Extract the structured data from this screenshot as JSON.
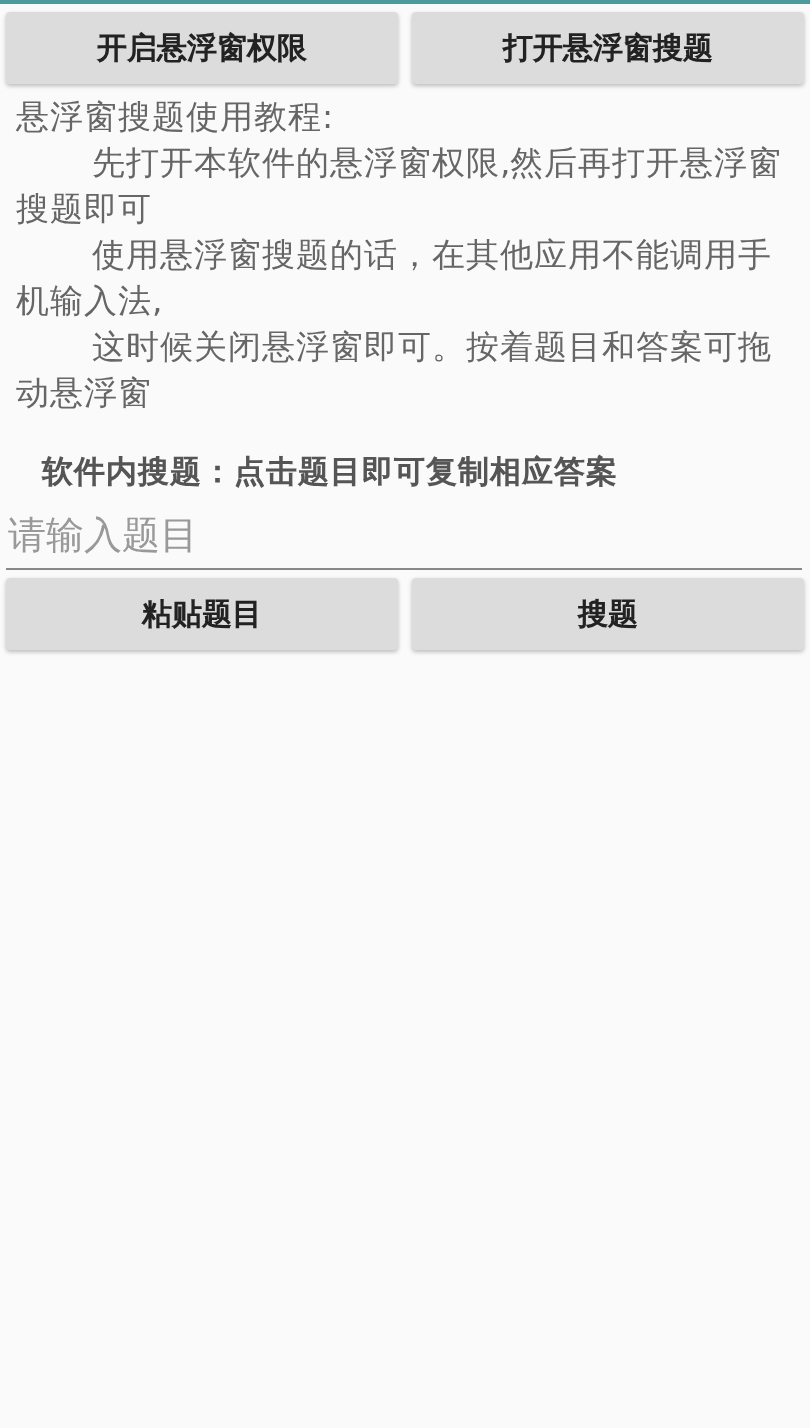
{
  "top_buttons": [
    "开启悬浮窗权限",
    "打开悬浮窗搜题"
  ],
  "tutorial": {
    "title": "悬浮窗搜题使用教程:",
    "paragraphs": [
      "先打开本软件的悬浮窗权限,然后再打开悬浮窗搜题即可",
      "使用悬浮窗搜题的话，在其他应用不能调用手机输入法,",
      "这时候关闭悬浮窗即可。按着题目和答案可拖动悬浮窗"
    ]
  },
  "in_app_hint": "软件内搜题：点击题目即可复制相应答案",
  "search": {
    "placeholder": "请输入题目"
  },
  "bottom_buttons": [
    "粘贴题目",
    "搜题"
  ]
}
